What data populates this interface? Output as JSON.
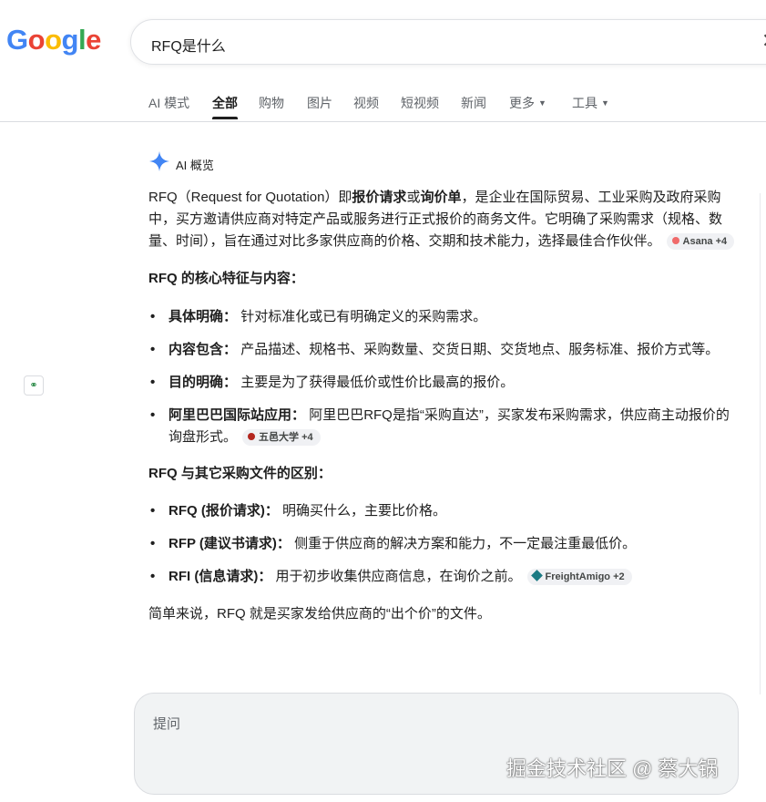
{
  "logo": {
    "letters": [
      "G",
      "o",
      "o",
      "g",
      "l",
      "e"
    ],
    "colors": [
      "#4285F4",
      "#EA4335",
      "#FBBC05",
      "#4285F4",
      "#34A853",
      "#EA4335"
    ]
  },
  "search": {
    "query": "RFQ是什么",
    "close_glyph": "✕"
  },
  "tabs": [
    {
      "label": "AI 模式"
    },
    {
      "label": "全部"
    },
    {
      "label": "购物"
    },
    {
      "label": "图片"
    },
    {
      "label": "视频"
    },
    {
      "label": "短视频"
    },
    {
      "label": "新闻"
    },
    {
      "label": "更多"
    },
    {
      "label": "工具"
    }
  ],
  "overview": {
    "title": "AI 概览",
    "intro": {
      "p1": "RFQ（Request for Quotation）即",
      "b1": "报价请求",
      "p2": "或",
      "b2": "询价单",
      "p3": "，是企业在国际贸易、工业采购及政府采购中，买方邀请供应商对特定产品或服务进行正式报价的商务文件。它明确了采购需求（规格、数量、时间），旨在通过对比多家供应商的价格、交期和技术能力，选择最佳合作伙伴。",
      "chip": "Asana +4"
    },
    "section1": {
      "title": "RFQ 的核心特征与内容：",
      "items": [
        {
          "term": "具体明确：",
          "text": "针对标准化或已有明确定义的采购需求。"
        },
        {
          "term": "内容包含：",
          "text": "产品描述、规格书、采购数量、交货日期、交货地点、服务标准、报价方式等。"
        },
        {
          "term": "目的明确：",
          "text": "主要是为了获得最低价或性价比最高的报价。"
        },
        {
          "term": "阿里巴巴国际站应用：",
          "text": "阿里巴巴RFQ是指“采购直达”，买家发布采购需求，供应商主动报价的询盘形式。",
          "chip": "五邑大学 +4"
        }
      ]
    },
    "section2": {
      "title": "RFQ 与其它采购文件的区别：",
      "items": [
        {
          "term": "RFQ (报价请求)：",
          "text": "明确买什么，主要比价格。"
        },
        {
          "term": "RFP (建议书请求)：",
          "text": "侧重于供应商的解决方案和能力，不一定最注重最低价。"
        },
        {
          "term": "RFI (信息请求)：",
          "text": "用于初步收集供应商信息，在询价之前。",
          "chip": "FreightAmigo +2"
        }
      ]
    },
    "summary": "简单来说，RFQ 就是买家发给供应商的“出个价”的文件。"
  },
  "ask": {
    "placeholder": "提问"
  },
  "watermark": "掘金技术社区 @ 蔡大锅",
  "colors": {
    "asana": "#f06a6a",
    "wuyi": "#b3261e",
    "freight": "#1b7a83",
    "spark_blue": "#4285F4"
  }
}
